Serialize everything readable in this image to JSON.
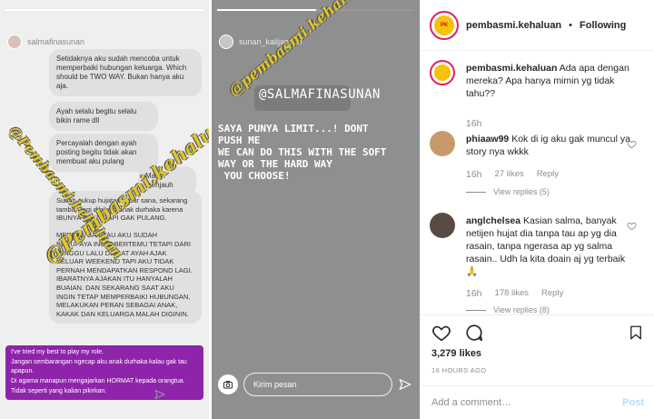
{
  "story_left": {
    "username": "salmafinasunan",
    "progress_fraction": 1.0,
    "bubbles": [
      "Setidaknya aku sudah mencoba untuk memperbaiki hubungan keluarga. Which should be TWO WAY. Bukan hanya aku aja.",
      "Ayah selalu begitu selalu bikin rame dll",
      "Percayalah dengan ayah posting begitu tidak akan membuat aku pulang",
      "Malah menjauh",
      "Sudah cukup hujatan diluar sana, sekarang tambah lagi dibilang anak durhaka karena IBUNYA SAKIT TAPI GAK PULANG.\n\nMEREKA GAK TAU AKU SUDAH BERUPAYA INGIN BERTEMU TETAPI DARI MINGGU LALU DISAAT AYAH AJAK KELUAR WEEKEND TAPI AKU TIDAK PERNAH MENDAPATKAN RESPOND LAGI. IBARATNYA AJAKAN ITU HANYALAH BUAIAN. DAN SEKARANG SAAT AKU INGIN TETAP MEMPERBAIKI HUBUNGAN, MELAKUKAN PERAN SEBAGAI ANAK, KAKAK DAN KELUARGA MALAH DIGININ."
    ],
    "purple_lines": [
      "I've tried my best to play my role.",
      "Jangan sembarangan ngecap aku anak durhaka kalau gak tau apapun.",
      "Di agama manapun mengajarkan HORMAT kepada orangtua.",
      "Tidak seperti yang kalian pikirkan."
    ],
    "watermark_1": "@Pembasmi.kehaluan",
    "watermark_2": "@Pembasmi.kehaluan"
  },
  "story_right": {
    "username": "sunan_kalijagash",
    "progress_fraction": 0.5,
    "handle_label": "@SALMAFINASUNAN",
    "watermark": "@pembasmi.kehaluan",
    "text_lines": [
      "SAYA PUNYA LIMIT...! DONT",
      "PUSH ME",
      "WE CAN DO THIS WITH THE SOFT",
      "WAY OR THE HARD WAY",
      " YOU CHOOSE!"
    ],
    "send_placeholder": "Kirim pesan"
  },
  "post": {
    "author": "pembasmi.kehaluan",
    "separator": "•",
    "follow_state": "Following",
    "logo_text": "PK",
    "caption": {
      "username": "pembasmi.kehaluan",
      "text": "Ada apa dengan mereka? Apa hanya mimin yg tidak tahu??",
      "time": "16h"
    },
    "comments": [
      {
        "username": "phiaaw99",
        "text": "Kok di ig aku gak muncul ya story nya wkkk",
        "time": "16h",
        "likes": "27 likes",
        "reply": "Reply",
        "view_replies": "View replies (5)",
        "avatar_color": "#c79a6b"
      },
      {
        "username": "anglchelsea",
        "text": "Kasian salma, banyak netijen hujat dia tanpa tau ap yg dia rasain, tanpa ngerasa ap yg salma rasain.. Udh la kita doain aj yg terbaik🙏",
        "time": "16h",
        "likes": "178 likes",
        "reply": "Reply",
        "view_replies": "View replies (8)",
        "avatar_color": "#5a4a44"
      }
    ],
    "likes": "3,279 likes",
    "posted": "16 HOURS AGO",
    "add_comment_placeholder": "Add a comment…",
    "post_button": "Post"
  },
  "colors": {
    "purple_box": "#8e24aa",
    "watermark_yellow": "#e6cd28",
    "logo_ring": "#e02060",
    "post_button": "#b2dffc"
  }
}
